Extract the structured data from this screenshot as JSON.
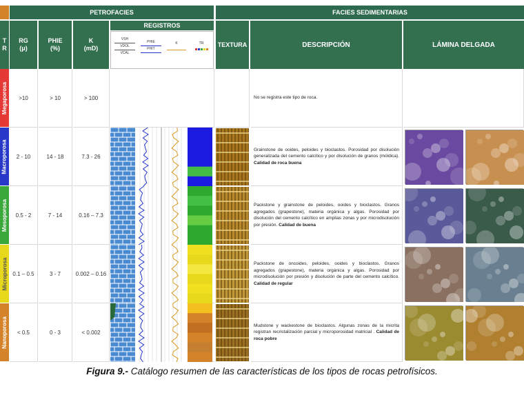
{
  "headers": {
    "petrofacies": "PETROFACIES",
    "facies": "FACIES SEDIMENTARIAS",
    "tr": "T\nR",
    "rg": "RG\n(μ)",
    "phie": "PHIE\n(%)",
    "k": "K\n(mD)",
    "registros": "REGISTROS",
    "textura": "TEXTURA",
    "descripcion": "DESCRIPCIÓN",
    "lamina": "LÁMINA DELGADA"
  },
  "registros": {
    "track1": [
      "VSH",
      "VDOL",
      "VCAL"
    ],
    "track2": [
      "PHIE",
      "PHIT"
    ],
    "track3": "K",
    "track4": "TR"
  },
  "rows": [
    {
      "name": "Megaporosa",
      "color": "#e53935",
      "rg": ">10",
      "phie": "> 10",
      "k": "> 100",
      "desc": "No se registra este tipo de roca.",
      "quality": ""
    },
    {
      "name": "Macroporosa",
      "color": "#2838c8",
      "rg": "2 - 10",
      "phie": "14 - 18",
      "k": "7.3 - 26",
      "desc": "Grainstone de ooides, peloides y bioclastos. Porosidad por disolución generalizada del cemento calcítico y por disolución de granos (móldica).",
      "quality": "Calidad de roca buena"
    },
    {
      "name": "Mesoporosa",
      "color": "#3aa83a",
      "rg": "0.5 - 2",
      "phie": "7 - 14",
      "k": "0.16 – 7.3",
      "desc": "Packstone y grainstone de peloides, ooides y bioclastos. Granos agregados (grapestone), materia orgánica y algas. Porosidad por disolución del cemento calcítico en amplias zonas y por microdisolución por presión.",
      "quality": "Calidad de buena"
    },
    {
      "name": "Microporosa",
      "color": "#e8d81c",
      "rg": "0.1 – 0.5",
      "phie": "3 - 7",
      "k": "0.002 – 0.16",
      "desc": "Packstone de oncoides, peloides, ooides y bioclastos. Granos agregados (grapestone), materia orgánica y algas. Porosidad por microdisolución por presión y disolución de parte del cemento calcítico.",
      "quality": "Calidad de regular"
    },
    {
      "name": "Nanoporosa",
      "color": "#d4832a",
      "rg": "< 0.5",
      "phie": "0 - 3",
      "k": "< 0.002",
      "desc": "Mudstone y wackestone de bioclastos. Algunas zonas de la micrita registran recristalización parcial y microporosidad matricial .",
      "quality": "Calidad de roca pobre"
    }
  ],
  "caption": {
    "label": "Figura 9.-",
    "text": " Catálogo resumen de las características de los tipos de rocas petrofísicos."
  }
}
